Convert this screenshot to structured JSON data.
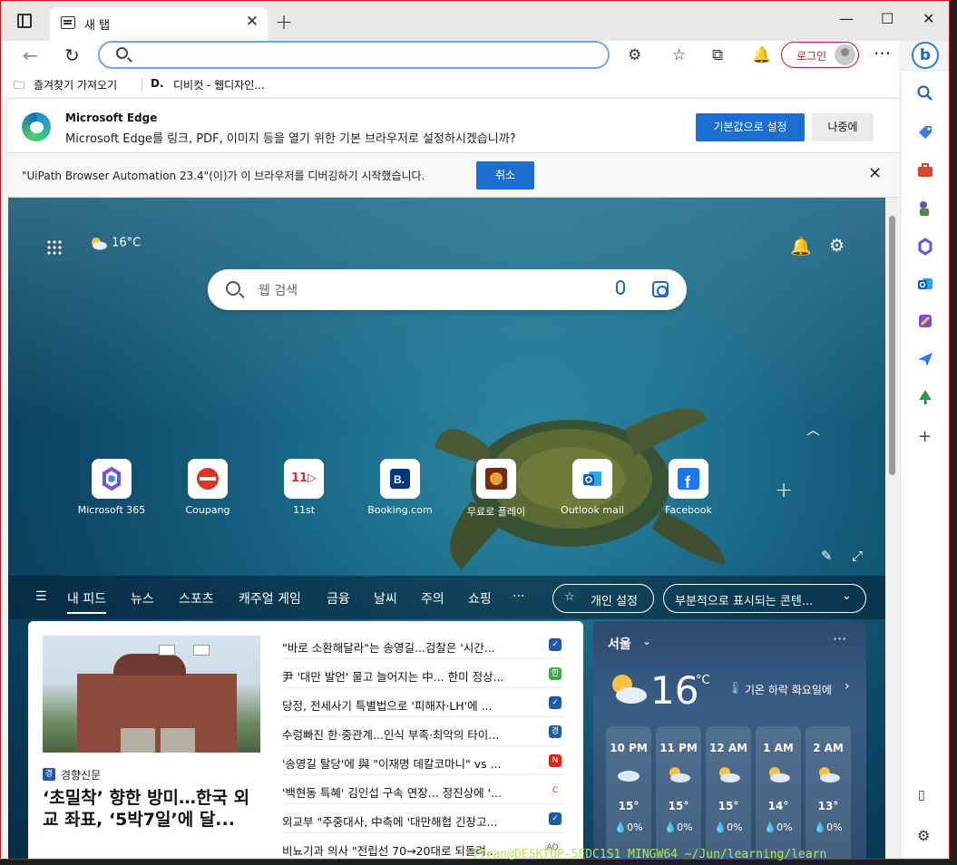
{
  "tab": {
    "title": "새 탭"
  },
  "window": {
    "minimize": "—",
    "maximize": "☐",
    "close": "✕"
  },
  "toolbar": {
    "login": "로그인",
    "more": "···"
  },
  "favorites": {
    "import": "즐겨찾기 가져오기",
    "site": "디비컷 - 웹디자인..."
  },
  "edge_prompt": {
    "title": "Microsoft Edge",
    "message": "Microsoft Edge를 링크, PDF, 이미지 등을 열기 위한 기본 브라우저로 설정하시겠습니까?",
    "primary": "기본값으로 설정",
    "secondary": "나중에"
  },
  "debug_bar": {
    "message": "\"UiPath Browser Automation 23.4\"(이)가 이 브라우저를 디버깅하기 시작했습니다.",
    "cancel": "취소"
  },
  "newtab": {
    "weather_small": "16°C",
    "search_placeholder": "웹 검색",
    "tiles": [
      {
        "label": "Microsoft 365"
      },
      {
        "label": "Coupang"
      },
      {
        "label": "11st"
      },
      {
        "label": "Booking.com"
      },
      {
        "label": "무료로 플레이"
      },
      {
        "label": "Outlook mail"
      },
      {
        "label": "Facebook"
      }
    ],
    "nav": [
      "내 피드",
      "뉴스",
      "스포츠",
      "캐주얼 게임",
      "금융",
      "날씨",
      "주의",
      "쇼핑",
      "···"
    ],
    "personalize": "개인 설정",
    "content_visibility": "부분적으로 표시되는 콘텐..."
  },
  "news": {
    "source": "경향신문",
    "headline": "‘초밀착’ 향한 방미…한국 외교 좌표, ‘5박7일’에 달...",
    "items": [
      {
        "text": "\"바로 소환해달라\"는 송영길...검찰은 '시간...",
        "color": "#1f5aa8"
      },
      {
        "text": "尹 '대만 발언' 물고 늘어지는 中... 한미 정상...",
        "color": "#3fae49"
      },
      {
        "text": "당정, 전세사기 특별법으로 '피해자·LH'에 ...",
        "color": "#1f5aa8"
      },
      {
        "text": "수렁빠진 한·중관계...인식 부족·최악의 타이...",
        "color": "#1f5aa8"
      },
      {
        "text": "'송영길 탈당'에 與 \"이재명 데칼코마니\" vs ...",
        "color": "#e2231a"
      },
      {
        "text": "'백현동 특혜' 김인섭 구속 연장... 정진상에 '...",
        "color": "#ffffff"
      },
      {
        "text": "외교부 \"주중대사, 中측에 '대만해협 긴장고...",
        "color": "#1f5aa8"
      },
      {
        "text": "비뇨기과 의사 \"전립선 70→20대로 되돌려...",
        "color": "#eeeeee"
      }
    ],
    "ad": "AD"
  },
  "weather": {
    "city": "서울",
    "temp": "16",
    "unit": "°C",
    "alert": "기온 하락 화요일에",
    "hours": [
      {
        "time": "10 PM",
        "temp": "15°",
        "precip": "0%"
      },
      {
        "time": "11 PM",
        "temp": "15°",
        "precip": "0%"
      },
      {
        "time": "12 AM",
        "temp": "15°",
        "precip": "0%"
      },
      {
        "time": "1 AM",
        "temp": "14°",
        "precip": "0%"
      },
      {
        "time": "2 AM",
        "temp": "13°",
        "precip": "0%"
      }
    ]
  },
  "background_terminal": "TYran@DESKTOP-5EDC1S1 MINGW64 ~/Jun/learning/learn"
}
